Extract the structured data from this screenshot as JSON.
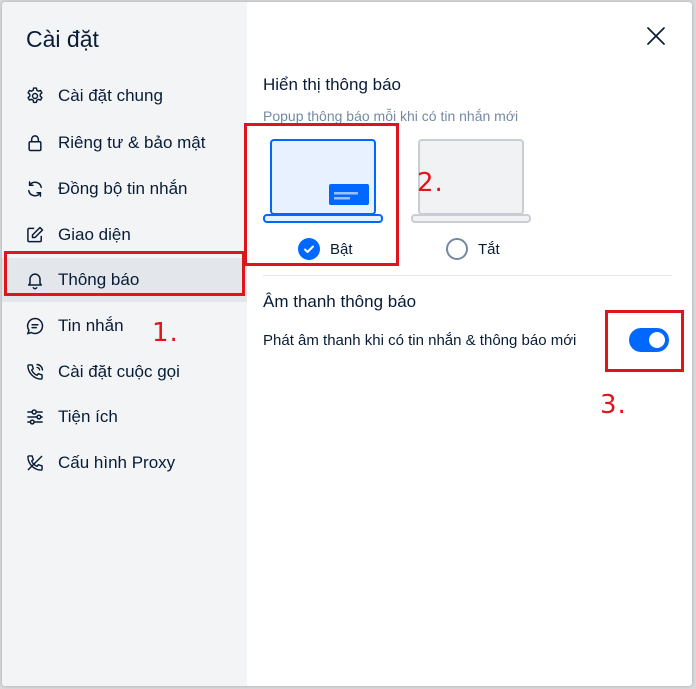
{
  "dialog": {
    "title": "Cài đặt"
  },
  "sidebar": {
    "items": [
      {
        "label": "Cài đặt chung",
        "icon": "gear-icon"
      },
      {
        "label": "Riêng tư & bảo mật",
        "icon": "lock-icon"
      },
      {
        "label": "Đồng bộ tin nhắn",
        "icon": "sync-icon"
      },
      {
        "label": "Giao diện",
        "icon": "edit-icon"
      },
      {
        "label": "Thông báo",
        "icon": "bell-icon",
        "active": true
      },
      {
        "label": "Tin nhắn",
        "icon": "chat-icon"
      },
      {
        "label": "Cài đặt cuộc gọi",
        "icon": "phone-icon"
      },
      {
        "label": "Tiện ích",
        "icon": "sliders-icon"
      },
      {
        "label": "Cấu hình Proxy",
        "icon": "proxy-icon"
      }
    ]
  },
  "notifications": {
    "display_title": "Hiển thị thông báo",
    "display_desc": "Popup thông báo mỗi khi có tin nhắn mới",
    "options": [
      {
        "label": "Bật",
        "selected": true
      },
      {
        "label": "Tắt",
        "selected": false
      }
    ],
    "sound_title": "Âm thanh thông báo",
    "sound_desc": "Phát âm thanh khi có tin nhắn & thông báo mới",
    "sound_enabled": true
  },
  "annotations": {
    "step1": "1.",
    "step2": "2.",
    "step3": "3."
  },
  "colors": {
    "accent": "#0068ff",
    "annotation": "#e0141b",
    "sidebar_bg": "#f3f4f6",
    "active_bg": "#e3e6ea"
  }
}
